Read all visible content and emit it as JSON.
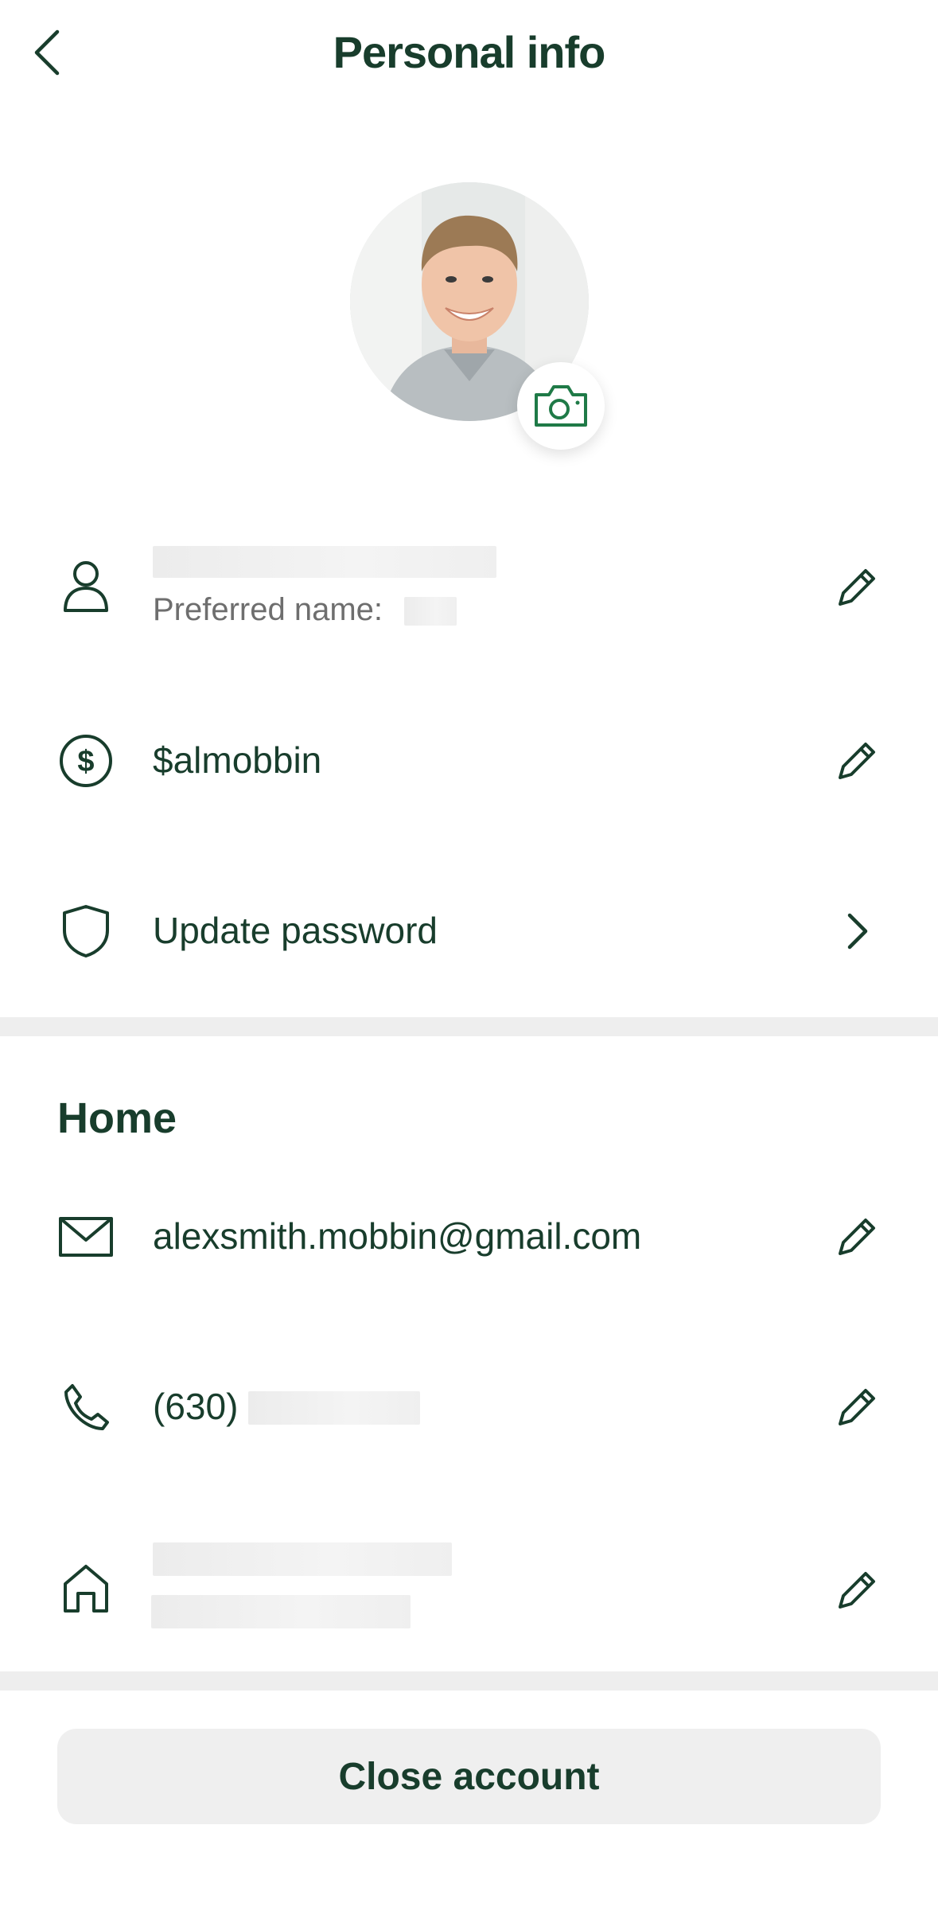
{
  "header": {
    "title": "Personal info",
    "back_icon": "chevron-left-icon"
  },
  "profile": {
    "avatar": "profile-photo",
    "camera_icon": "camera-icon",
    "accent_color": "#1f7a47"
  },
  "rows": {
    "name": {
      "sub_label": "Preferred name:",
      "icon": "person-icon",
      "action_icon": "pencil-icon"
    },
    "cashtag": {
      "value": "$almobbin",
      "icon": "dollar-circle-icon",
      "action_icon": "pencil-icon"
    },
    "password": {
      "label": "Update password",
      "icon": "shield-icon",
      "action_icon": "chevron-right-icon"
    }
  },
  "home": {
    "title": "Home",
    "email": {
      "value": "alexsmith.mobbin@gmail.com",
      "icon": "mail-icon"
    },
    "phone": {
      "value": "(630)",
      "icon": "phone-icon"
    },
    "address": {
      "icon": "home-icon"
    }
  },
  "footer": {
    "close_label": "Close account"
  },
  "colors": {
    "text": "#183d2c",
    "divider": "#eeeeee",
    "button_bg": "#efefef"
  }
}
